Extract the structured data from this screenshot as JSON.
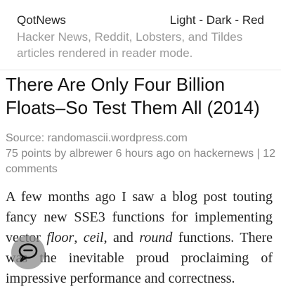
{
  "site": {
    "name": "QotNews",
    "themes": [
      "Light",
      "Dark",
      "Red"
    ],
    "separator": "-",
    "tagline": "Hacker News, Reddit, Lobsters, and Tildes articles rendered in reader mode."
  },
  "article": {
    "title": "There Are Only Four Billion Floats–So Test Them All (2014)",
    "source_label": "Source:",
    "source": "randomascii.wordpress.com",
    "points": "75 points",
    "by_label": "by",
    "author": "albrewer",
    "age": "6 hours ago",
    "on_label": "on",
    "site_link": "hackernews",
    "pipe": "|",
    "comments": "12 comments",
    "body": {
      "p1_a": "A few months ago I saw a blog post touting fancy new SSE3 functions for implementing vector ",
      "floor": "floor",
      "comma1": ", ",
      "ceil": "ceil",
      "and": ", and ",
      "round": "round",
      "p1_b": " functions. There was the inevitable proud proclaiming of impressive performance and correctness."
    }
  },
  "fab": {
    "icon": "comment-icon"
  }
}
